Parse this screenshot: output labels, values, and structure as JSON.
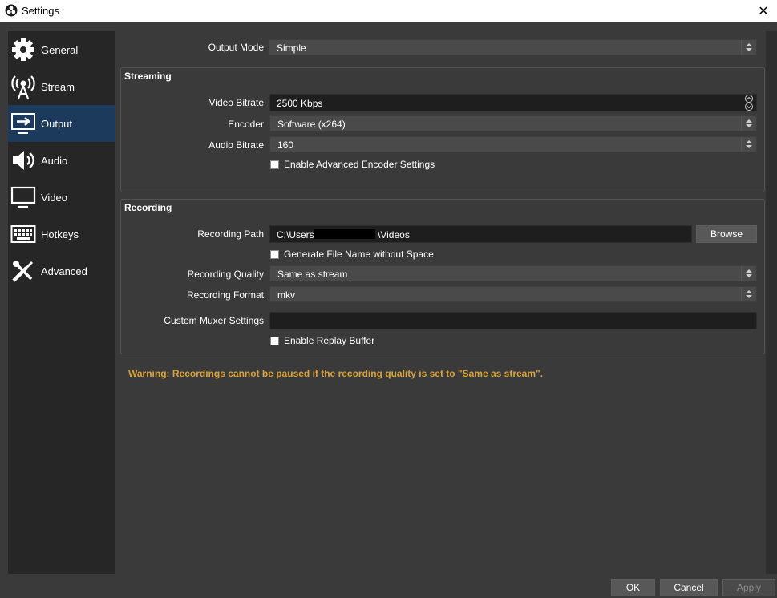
{
  "window": {
    "title": "Settings",
    "close_icon": "close-icon"
  },
  "sidebar": {
    "items": [
      {
        "label": "General",
        "icon": "gear-icon"
      },
      {
        "label": "Stream",
        "icon": "antenna-icon"
      },
      {
        "label": "Output",
        "icon": "output-icon",
        "active": true
      },
      {
        "label": "Audio",
        "icon": "speaker-icon"
      },
      {
        "label": "Video",
        "icon": "monitor-icon"
      },
      {
        "label": "Hotkeys",
        "icon": "keyboard-icon"
      },
      {
        "label": "Advanced",
        "icon": "tools-icon"
      }
    ]
  },
  "output_mode": {
    "label": "Output Mode",
    "value": "Simple"
  },
  "streaming": {
    "title": "Streaming",
    "video_bitrate": {
      "label": "Video Bitrate",
      "value": "2500 Kbps"
    },
    "encoder": {
      "label": "Encoder",
      "value": "Software (x264)"
    },
    "audio_bitrate": {
      "label": "Audio Bitrate",
      "value": "160"
    },
    "advanced_encoder": {
      "label": "Enable Advanced Encoder Settings",
      "checked": false
    }
  },
  "recording": {
    "title": "Recording",
    "path": {
      "label": "Recording Path",
      "value_prefix": "C:\\Users\\",
      "value_suffix": "\\Videos"
    },
    "browse_label": "Browse",
    "no_space": {
      "label": "Generate File Name without Space",
      "checked": false
    },
    "quality": {
      "label": "Recording Quality",
      "value": "Same as stream"
    },
    "format": {
      "label": "Recording Format",
      "value": "mkv"
    },
    "muxer": {
      "label": "Custom Muxer Settings",
      "value": ""
    },
    "replay_buffer": {
      "label": "Enable Replay Buffer",
      "checked": false
    }
  },
  "warning": "Warning: Recordings cannot be paused if the recording quality is set to \"Same as stream\".",
  "footer": {
    "ok": "OK",
    "cancel": "Cancel",
    "apply": "Apply"
  },
  "colors": {
    "accent": "#1c3a5c",
    "warning": "#d9a23a",
    "sidebar_bg": "#262626",
    "panel_bg": "#3a3a3a"
  }
}
